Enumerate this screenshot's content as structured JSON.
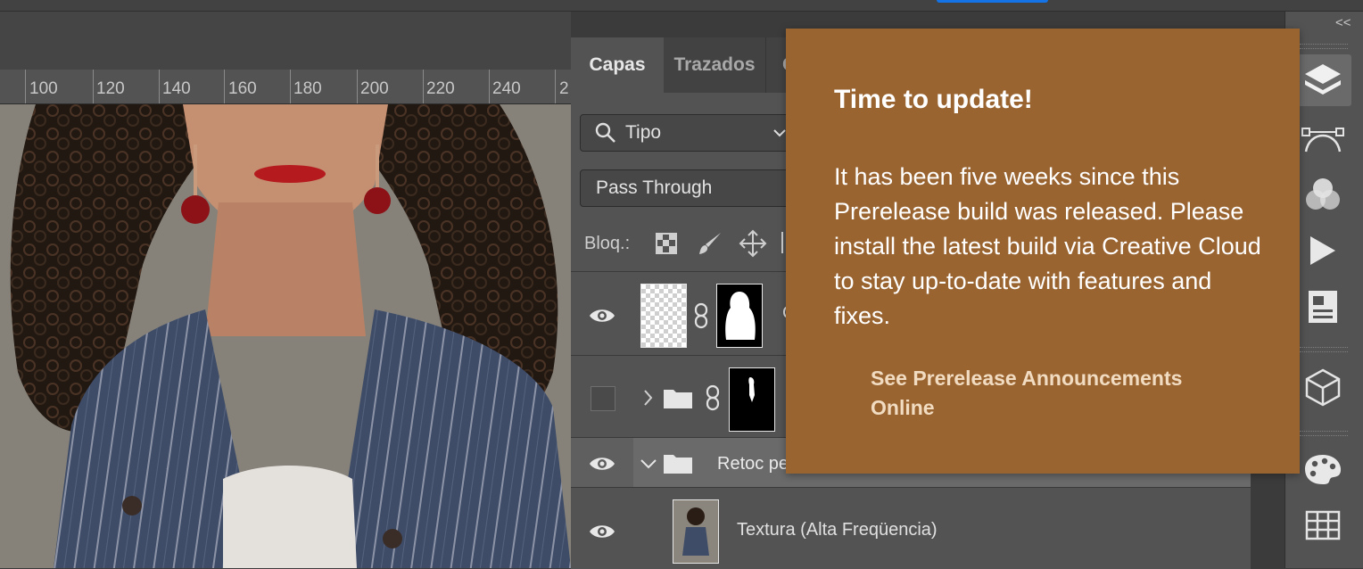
{
  "ruler": {
    "labels": [
      "100",
      "120",
      "140",
      "160",
      "180",
      "200",
      "220",
      "240",
      "2"
    ]
  },
  "layers_panel": {
    "tabs": [
      {
        "label": "Capas",
        "active": true
      },
      {
        "label": "Trazados",
        "active": false
      },
      {
        "label": "C",
        "active": false
      }
    ],
    "filter_dropdown": "Tipo",
    "blend_mode": "Pass Through",
    "lock_label": "Bloq.:",
    "layers": [
      {
        "name": "C",
        "visible": true
      },
      {
        "name": "",
        "visible": false
      },
      {
        "name": "Retoc pe",
        "visible": true
      },
      {
        "name": "Textura (Alta Freqüencia)",
        "visible": true
      }
    ]
  },
  "popup": {
    "title": "Time to update!",
    "body": "It has been five weeks since this Prerelease build was released. Please install the latest build via Creative Cloud to stay up-to-date with features and fixes.",
    "link": "See Prerelease Announcements Online"
  },
  "sidebar": {
    "collapse_label": "<<",
    "icons": [
      "layers-icon",
      "paths-icon",
      "channels-icon",
      "actions-icon",
      "properties-icon",
      "3d-icon",
      "swatches-icon",
      "grid-icon"
    ]
  },
  "colors": {
    "popup_bg": "#9a6431",
    "panel_bg": "#535353",
    "accent_blue": "#1473e6"
  }
}
